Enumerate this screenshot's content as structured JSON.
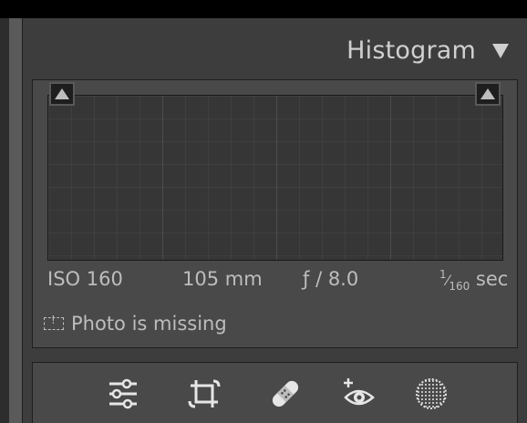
{
  "panel": {
    "title": "Histogram",
    "collapse_icon": "triangle-down-icon"
  },
  "histogram": {
    "shadow_clip_icon": "triangle-up-icon",
    "highlight_clip_icon": "triangle-up-icon",
    "iso": "ISO 160",
    "focal_length": "105 mm",
    "aperture": "ƒ / 8.0",
    "shutter_numerator": "1",
    "shutter_denominator": "160",
    "shutter_unit": "sec",
    "status_icon": "missing-photo-icon",
    "status_text": "Photo is missing"
  },
  "toolstrip": [
    {
      "name": "edit-sliders",
      "icon": "sliders-icon"
    },
    {
      "name": "crop",
      "icon": "crop-icon"
    },
    {
      "name": "healing",
      "icon": "bandage-icon"
    },
    {
      "name": "red-eye",
      "icon": "eye-icon"
    },
    {
      "name": "masking",
      "icon": "mask-circle-icon"
    }
  ],
  "colors": {
    "panel_bg": "#3d3d3d",
    "box_bg": "#494949",
    "graph_bg": "#363636",
    "text": "#bdbdbd",
    "icon": "#e6e6e6"
  }
}
